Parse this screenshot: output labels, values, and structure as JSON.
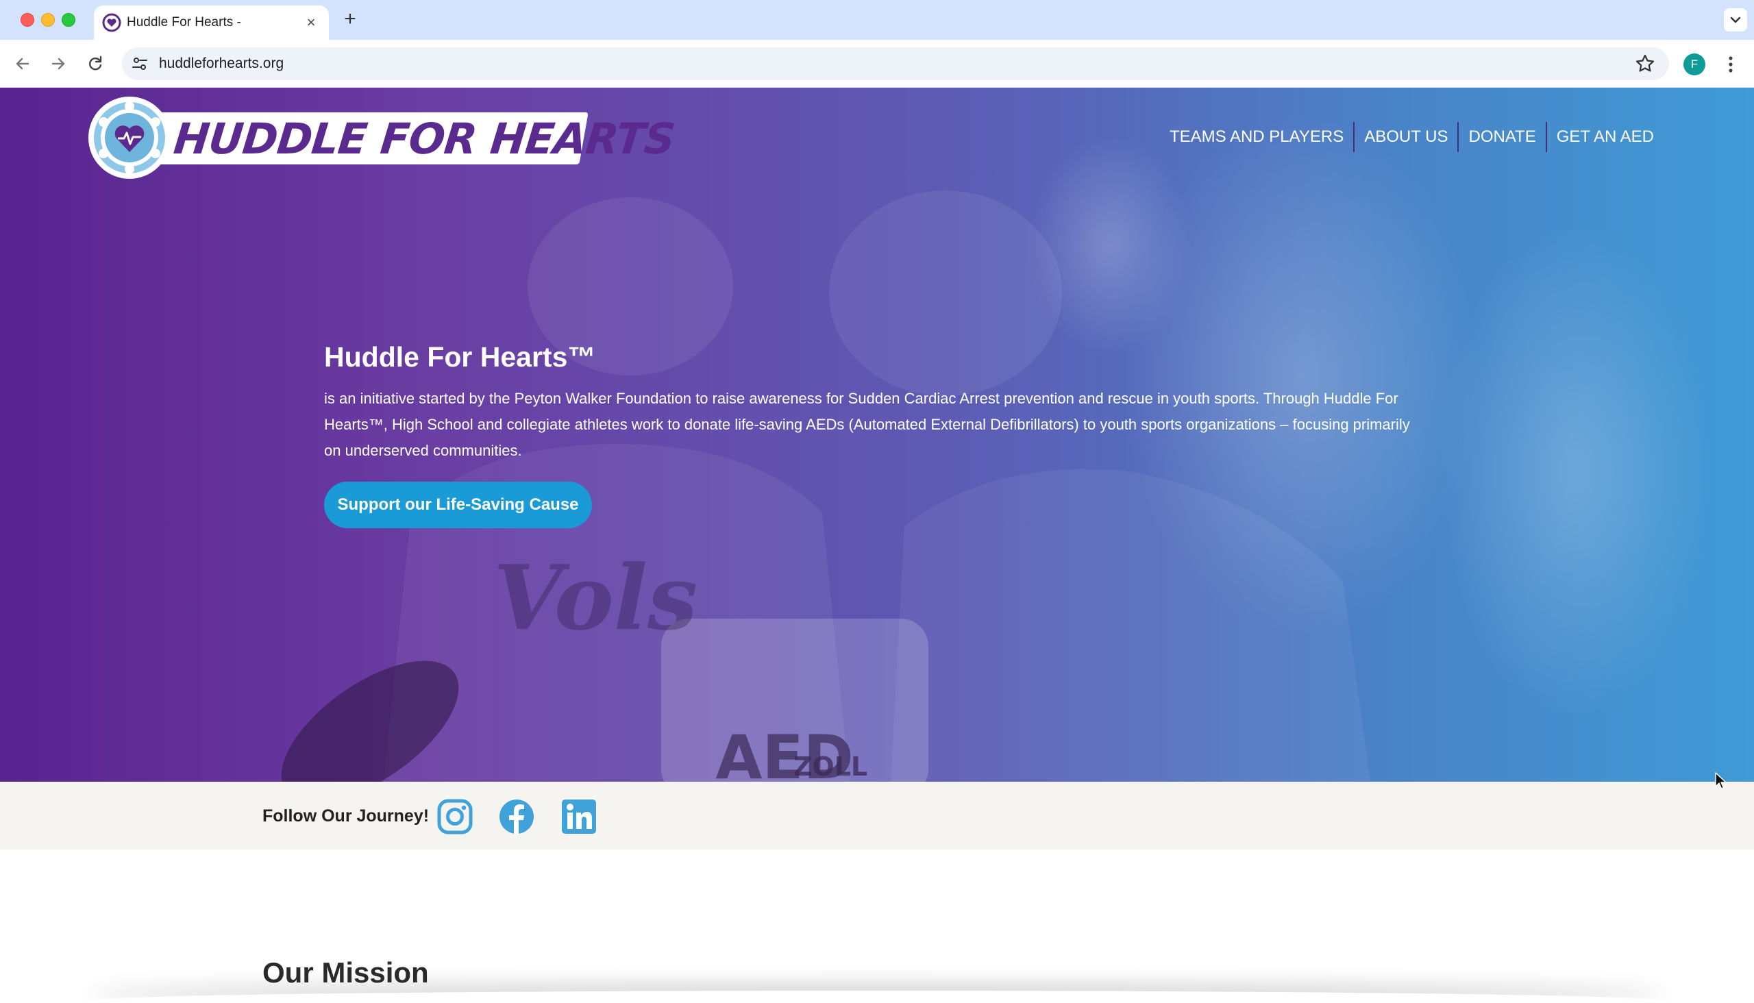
{
  "browser": {
    "tab_title": "Huddle For Hearts -",
    "url": "huddleforhearts.org",
    "profile_initial": "F"
  },
  "site": {
    "logo_text": "HUDDLE FOR HEARTS",
    "nav": [
      {
        "label": "TEAMS AND PLAYERS"
      },
      {
        "label": "ABOUT US"
      },
      {
        "label": "DONATE"
      },
      {
        "label": "GET AN AED"
      }
    ],
    "hero": {
      "title": "Huddle For Hearts™",
      "text": "is an initiative started by the Peyton Walker Foundation to raise awareness for Sudden Cardiac Arrest prevention and rescue in youth sports. Through Huddle For Hearts™, High School and collegiate athletes work to donate life-saving AEDs (Automated External Defibrillators) to youth sports organizations – focusing primarily on underserved communities.",
      "cta": "Support our Life-Saving Cause",
      "photo_text": {
        "brand": "ZOLL",
        "device": "AED",
        "shirt": "Vols"
      }
    },
    "social": {
      "label": "Follow Our Journey!",
      "icons": [
        "instagram-icon",
        "facebook-icon",
        "linkedin-icon"
      ]
    },
    "mission": {
      "title": "Our Mission"
    }
  },
  "colors": {
    "brand_purple": "#5b2a8f",
    "brand_blue": "#1a9ad6",
    "social_blue": "#3fa2d8"
  }
}
